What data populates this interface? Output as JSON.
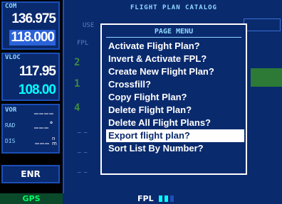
{
  "com": {
    "label": "COM",
    "active": "136.975",
    "standby": "118.000"
  },
  "vloc": {
    "label": "VLOC",
    "active": "117.95",
    "standby": "108.00"
  },
  "vor": {
    "label": "VOR",
    "rad_label": "RAD",
    "dis_label": "DIS",
    "vor_value": "____",
    "rad_value": "___°",
    "dis_value": "___",
    "dis_unit": "n m"
  },
  "mode": {
    "enr": "ENR",
    "gps": "GPS"
  },
  "page": {
    "title": "FLIGHT PLAN CATALOG",
    "col_use": "USE",
    "col_fpl": "FPL",
    "rows": [
      "2",
      "1",
      "4"
    ]
  },
  "status": {
    "fpl": "FPL"
  },
  "menu": {
    "title": "PAGE MENU",
    "items": [
      "Activate Flight Plan?",
      "Invert & Activate FPL?",
      "Create New Flight Plan?",
      "Crossfill?",
      "Copy Flight Plan?",
      "Delete Flight Plan?",
      "Delete All Flight Plans?",
      "Export flight plan?",
      "Sort List By Number?"
    ],
    "selected_index": 7
  },
  "colors": {
    "background": "#0a2a6e",
    "standby_freq": "#00ffff",
    "label": "#8fd8ff",
    "selection": "#ffffff",
    "gps": "#00ff66"
  }
}
